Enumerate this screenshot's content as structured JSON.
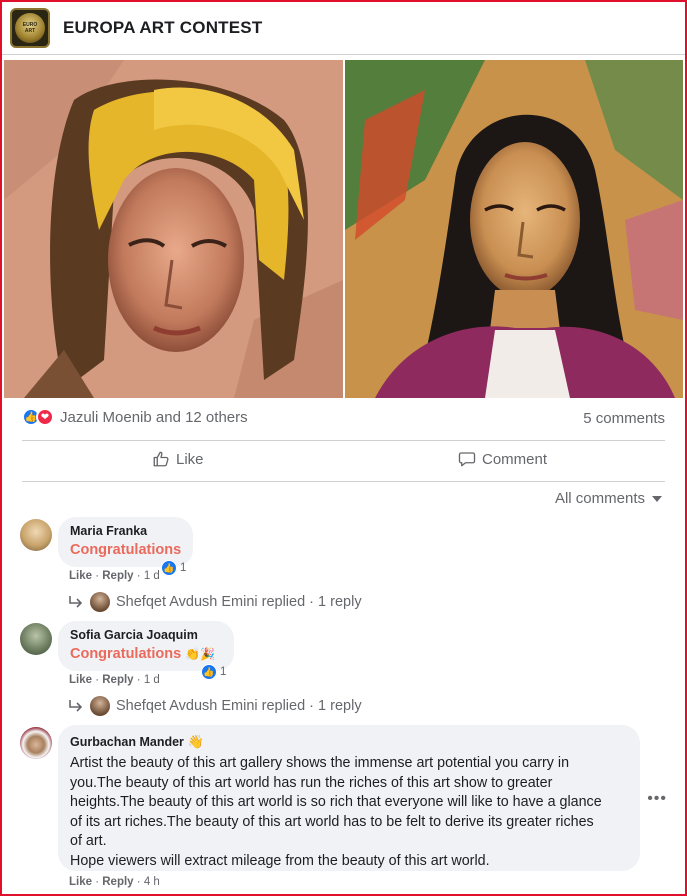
{
  "header": {
    "page_title": "EUROPA ART CONTEST",
    "logo_icon": "europa-art-contest-logo"
  },
  "post": {
    "images": [
      "painting-portrait-yellow-hair",
      "painting-portrait-dark-hair"
    ],
    "reactions": {
      "icons": [
        "like-reaction-icon",
        "love-reaction-icon"
      ],
      "reactors": "Jazuli Moenib and 12 others",
      "comment_count": "5 comments"
    },
    "actions": {
      "like_label": "Like",
      "comment_label": "Comment"
    },
    "sort_label": "All comments"
  },
  "comments": [
    {
      "author": "Maria Franka",
      "text": "Congratulations",
      "like": "Like",
      "reply": "Reply",
      "time": "1 d",
      "reaction_count": "1",
      "replies": "Shefqet Avdush Emini replied · 1 reply"
    },
    {
      "author": "Sofia Garcia Joaquim",
      "text": "Congratulations",
      "like": "Like",
      "reply": "Reply",
      "time": "1 d",
      "reaction_count": "1",
      "replies": "Shefqet Avdush Emini replied · 1 reply"
    },
    {
      "author": "Gurbachan Mander",
      "text_lines": [
        "Artist the beauty of this art gallery shows the immense art potential you carry in",
        "you.The beauty of this art world has run the riches of this art show to greater",
        "heights.The beauty of this art world is so rich that everyone will like to have a glance",
        "of its art riches.The beauty of this art world has to be felt to derive its greater riches",
        "of art.",
        "Hope viewers will extract mileage from the beauty of this art world."
      ],
      "like": "Like",
      "reply": "Reply",
      "time": "4 h"
    }
  ],
  "colors": {
    "frame_border": "#e0102a",
    "facebook_blue": "#1877f2",
    "comment_highlight": "#ea6a5c",
    "bubble_bg": "#f0f2f5",
    "secondary_text": "#65676b"
  }
}
